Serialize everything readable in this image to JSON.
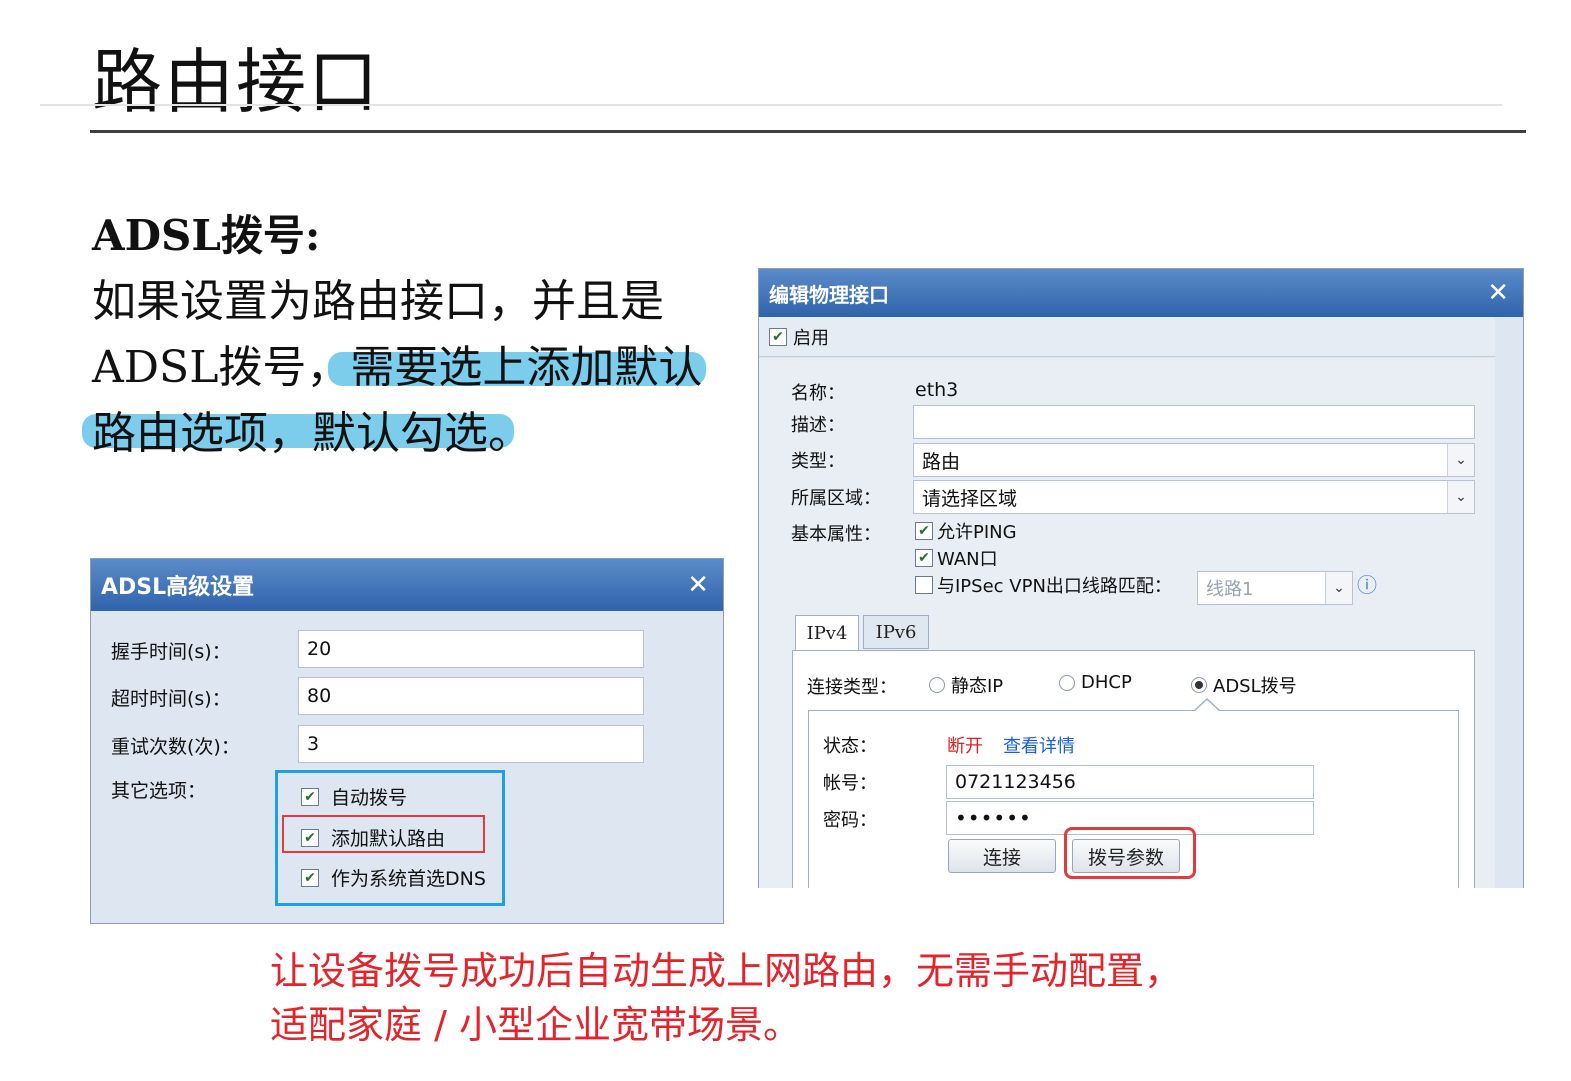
{
  "slide": {
    "title": "路由接口",
    "subhead": "ADSL拨号:",
    "paragraph": {
      "line1": "如果设置为路由接口，并且是",
      "line2_a": "ADSL拨号，",
      "line2_b": "需要选上添加默认",
      "line3": "路由选项，默认勾选。"
    },
    "caption": {
      "line1": "让设备拨号成功后自动生成上网路由，无需手动配置，",
      "line2": "适配家庭 / 小型企业宽带场景。"
    }
  },
  "adsl_dialog": {
    "title": "ADSL高级设置",
    "close": "✕",
    "fields": [
      {
        "label": "握手时间(s)：",
        "value": "20"
      },
      {
        "label": "超时时间(s)：",
        "value": "80"
      },
      {
        "label": "重试次数(次)：",
        "value": "3"
      }
    ],
    "other_label": "其它选项：",
    "options": [
      {
        "label": "自动拨号",
        "checked": true
      },
      {
        "label": "添加默认路由",
        "checked": true
      },
      {
        "label": "作为系统首选DNS",
        "checked": true
      }
    ]
  },
  "iface_dialog": {
    "title": "编辑物理接口",
    "close": "✕",
    "enable_label": "启用",
    "name_label": "名称：",
    "name_value": "eth3",
    "desc_label": "描述：",
    "desc_value": "",
    "type_label": "类型：",
    "type_value": "路由",
    "zone_label": "所属区域：",
    "zone_value": "请选择区域",
    "attr_label": "基本属性：",
    "attrs": [
      {
        "label": "允许PING",
        "checked": true
      },
      {
        "label": "WAN口",
        "checked": true
      },
      {
        "label": "与IPSec VPN出口线路匹配：",
        "checked": false
      }
    ],
    "line_value": "线路1",
    "info_icon": "ⓘ",
    "tabs": [
      "IPv4",
      "IPv6"
    ],
    "conn_label": "连接类型：",
    "conn_options": [
      "静态IP",
      "DHCP",
      "ADSL拨号"
    ],
    "conn_selected": "ADSL拨号",
    "status_label": "状态：",
    "status_value": "断开",
    "details_link": "查看详情",
    "account_label": "帐号：",
    "account_value": "0721123456",
    "password_label": "密码：",
    "password_value": "••••••",
    "connect_btn": "连接",
    "dial_params_btn": "拨号参数"
  },
  "colors": {
    "title_bar": "#2f63ab",
    "highlight": "#6ec6ea",
    "caption_red": "#e3242b",
    "box_blue": "#1ea0e6",
    "box_red": "#e23b3b",
    "status_red": "#e02020",
    "link_blue": "#1a5fd6"
  }
}
